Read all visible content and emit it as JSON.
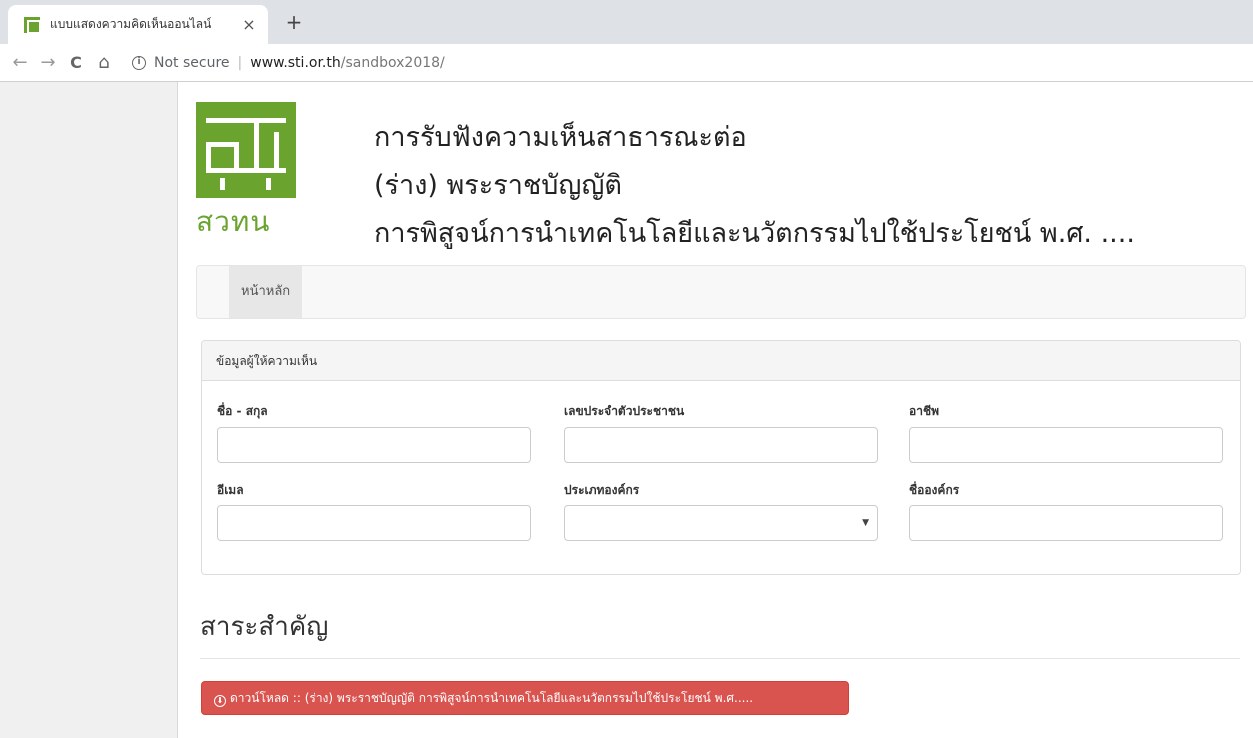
{
  "browser": {
    "tab_title": "แบบแสดงความคิดเห็นออนไลน์",
    "tab_close": "×",
    "new_tab": "+",
    "back": "←",
    "forward": "→",
    "reload": "C",
    "home": "⌂",
    "info": "i",
    "not_secure": "Not secure",
    "separator": "|",
    "url_host": "www.sti.or.th",
    "url_path": "/sandbox2018/"
  },
  "header": {
    "logo_text": "สวทน",
    "title_lines": [
      "การรับฟังความเห็นสาธารณะต่อ",
      "(ร่าง) พระราชบัญญัติ",
      "การพิสูจน์การนำเทคโนโลยีและนวัตกรรมไปใช้ประโยชน์ พ.ศ. ...."
    ]
  },
  "nav": {
    "home": "หน้าหลัก"
  },
  "form": {
    "heading": "ข้อมูลผู้ให้ความเห็น",
    "fields": {
      "name": {
        "label": "ชื่อ - สกุล",
        "value": ""
      },
      "national_id": {
        "label": "เลขประจำตัวประชาชน",
        "value": ""
      },
      "occupation": {
        "label": "อาชีพ",
        "value": ""
      },
      "email": {
        "label": "อีเมล",
        "value": ""
      },
      "org_type": {
        "label": "ประเภทองค์กร",
        "selected": ""
      },
      "org_name": {
        "label": "ชื่อองค์กร",
        "value": ""
      }
    }
  },
  "content": {
    "section_title": "สาระสำคัญ",
    "download_icon": "⬇",
    "download_label": "ดาวน์โหลด :: (ร่าง) พระราชบัญญัติ การพิสูจน์การนำเทคโนโลยีและนวัตกรรมไปใช้ประโยชน์ พ.ศ.....",
    "colors": {
      "brand_green": "#6aa42f",
      "danger": "#d9534f"
    }
  }
}
